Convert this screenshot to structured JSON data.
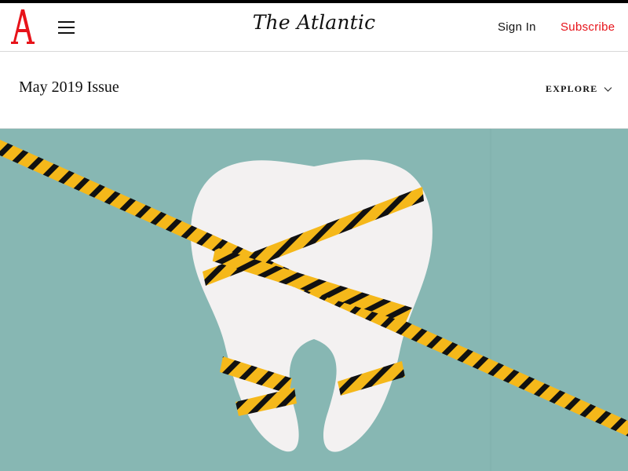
{
  "header": {
    "logo_letter": "A",
    "wordmark": "The Atlantic",
    "sign_in": "Sign In",
    "subscribe": "Subscribe",
    "icons": [
      "atlantic-logo-icon",
      "menu-icon"
    ]
  },
  "issue": {
    "title": "May 2019 Issue",
    "explore_label": "EXPLORE",
    "explore_icon": "chevron-down-icon"
  },
  "hero": {
    "image_subject": "tooth wrapped in caution tape",
    "background_color": "#87b7b3"
  },
  "colors": {
    "accent": "#e7131a",
    "tape_yellow": "#f5b81a",
    "tape_black": "#111111",
    "tooth": "#f3f1f1"
  }
}
